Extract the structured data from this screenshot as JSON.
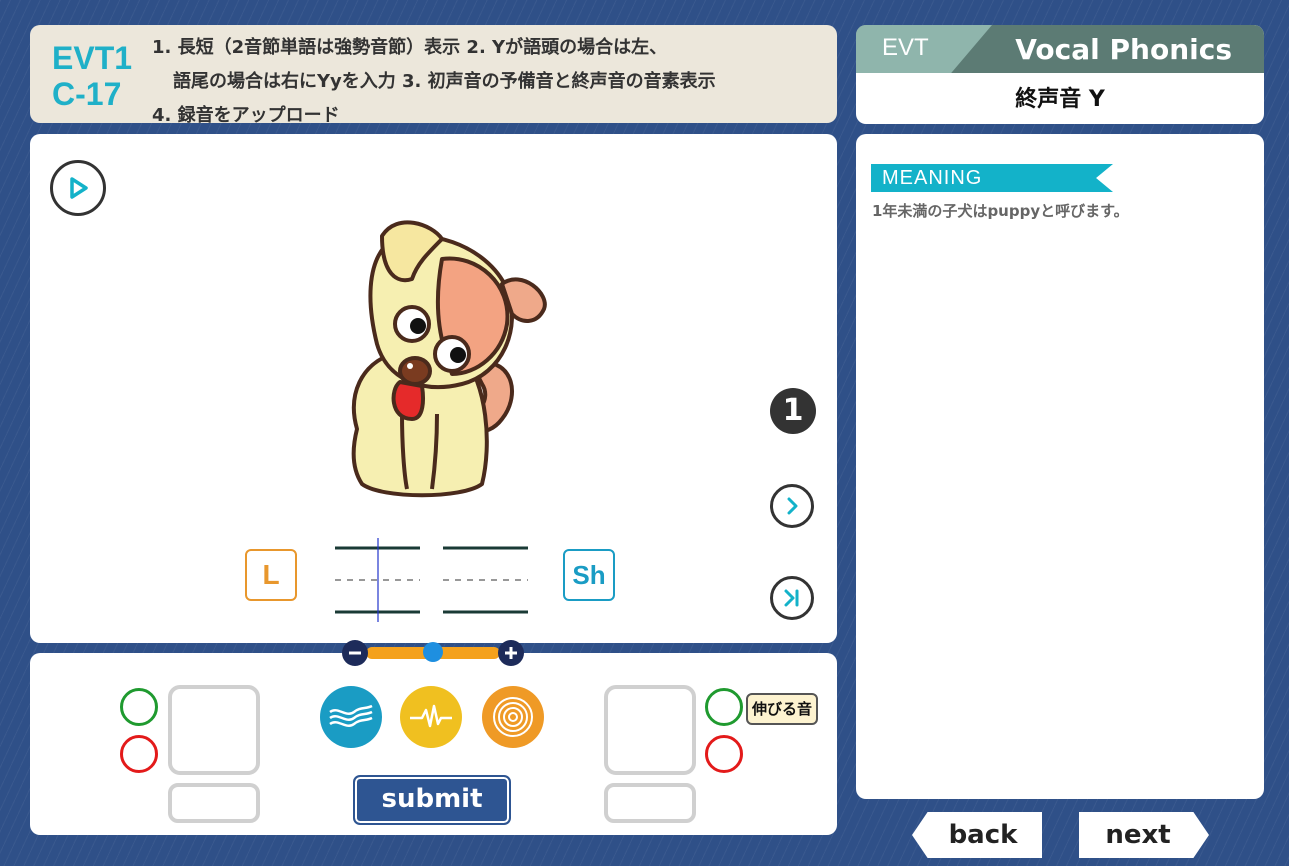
{
  "header": {
    "lesson_code_line1": "EVT1",
    "lesson_code_line2": "C-17",
    "instructions": [
      "1. 長短（2音節単語は強勢音節）表示 2. Yが語頭の場合は左、",
      "語尾の場合は右にYyを入力 3. 初声音の予備音と終声音の音素表示",
      "4. 録音をアップロード"
    ]
  },
  "title_panel": {
    "tab_label": "EVT",
    "app_title": "Vocal Phonics",
    "unit_title": "終声音 Y"
  },
  "main": {
    "play_icon": "play-icon",
    "page_number": "1",
    "left_letter": "L",
    "right_letter": "Sh",
    "illustration": "puppy"
  },
  "answer_area": {
    "sound_buttons": [
      {
        "name": "wave-icon",
        "color": "#1a9cc4"
      },
      {
        "name": "pulse-icon",
        "color": "#f0c020"
      },
      {
        "name": "ripple-icon",
        "color": "#ef9a26"
      }
    ],
    "submit_label": "submit",
    "long_sound_label": "伸びる音"
  },
  "meaning": {
    "tag": "MEANING",
    "text": "1年未満の子犬はpuppyと呼びます。"
  },
  "nav": {
    "back_label": "back",
    "next_label": "next"
  },
  "colors": {
    "accent": "#1fb0c8",
    "background": "#2f5088",
    "slider": "#f4a11c",
    "check_correct": "#1f9a2f",
    "check_wrong": "#e31a1a"
  }
}
